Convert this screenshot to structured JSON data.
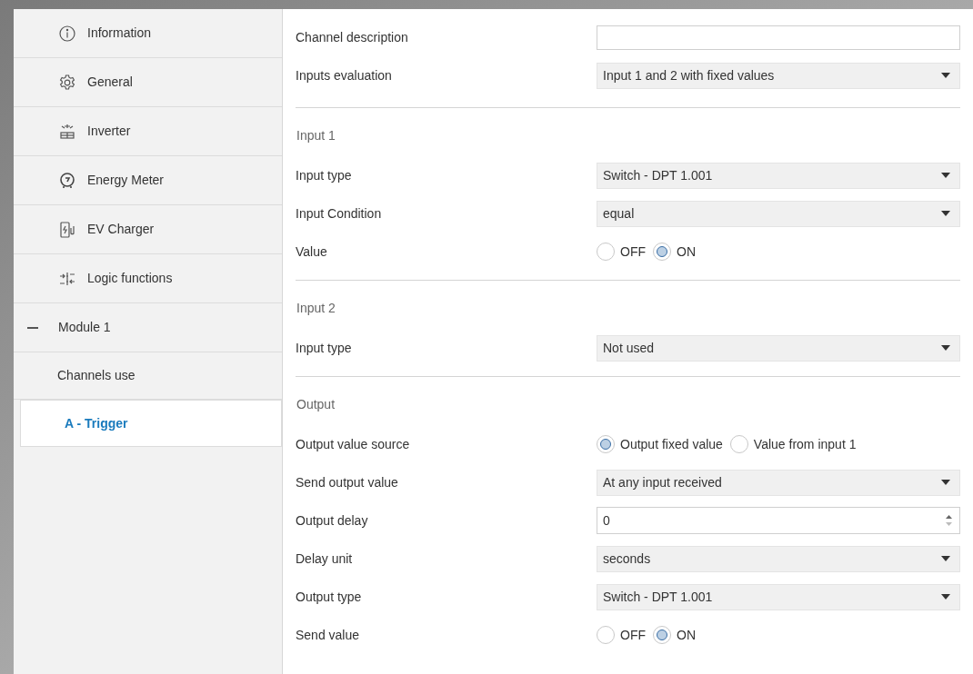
{
  "sidebar": {
    "items": [
      {
        "kind": "page",
        "label": "Information",
        "selected": false
      },
      {
        "kind": "page",
        "label": "General",
        "selected": false
      },
      {
        "kind": "page",
        "label": "Inverter",
        "selected": false
      },
      {
        "kind": "page",
        "label": "Energy Meter",
        "selected": false
      },
      {
        "kind": "page",
        "label": "EV Charger",
        "selected": false
      },
      {
        "kind": "page",
        "label": "Logic functions",
        "selected": false
      },
      {
        "kind": "group",
        "label": "Module 1",
        "expanded": true,
        "children": [
          {
            "label": "Channels use",
            "selected": false
          },
          {
            "label": "A - Trigger",
            "selected": true
          }
        ]
      }
    ]
  },
  "sections": [
    {
      "rows": [
        {
          "kind": "text",
          "label": "Channel description",
          "value": ""
        },
        {
          "kind": "select",
          "label": "Inputs evaluation",
          "value": "Input 1 and 2 with fixed values"
        }
      ]
    },
    {
      "title": "Input 1",
      "rows": [
        {
          "kind": "select",
          "label": "Input type",
          "value": "Switch - DPT 1.001"
        },
        {
          "kind": "select",
          "label": "Input Condition",
          "value": "equal"
        },
        {
          "kind": "radio",
          "label": "Value",
          "options": [
            {
              "label": "OFF",
              "selected": false
            },
            {
              "label": "ON",
              "selected": true
            }
          ]
        }
      ]
    },
    {
      "title": "Input 2",
      "rows": [
        {
          "kind": "select",
          "label": "Input type",
          "value": "Not used"
        }
      ]
    },
    {
      "title": "Output",
      "rows": [
        {
          "kind": "radio",
          "label": "Output value source",
          "options": [
            {
              "label": "Output fixed value",
              "selected": true
            },
            {
              "label": "Value from input 1",
              "selected": false
            }
          ]
        },
        {
          "kind": "select",
          "label": "Send output value",
          "value": "At any input received"
        },
        {
          "kind": "number",
          "label": "Output delay",
          "value": "0"
        },
        {
          "kind": "select",
          "label": "Delay unit",
          "value": "seconds"
        },
        {
          "kind": "select",
          "label": "Output type",
          "value": "Switch - DPT 1.001"
        },
        {
          "kind": "radio",
          "label": "Send value",
          "options": [
            {
              "label": "OFF",
              "selected": false
            },
            {
              "label": "ON",
              "selected": true
            }
          ]
        }
      ]
    }
  ]
}
